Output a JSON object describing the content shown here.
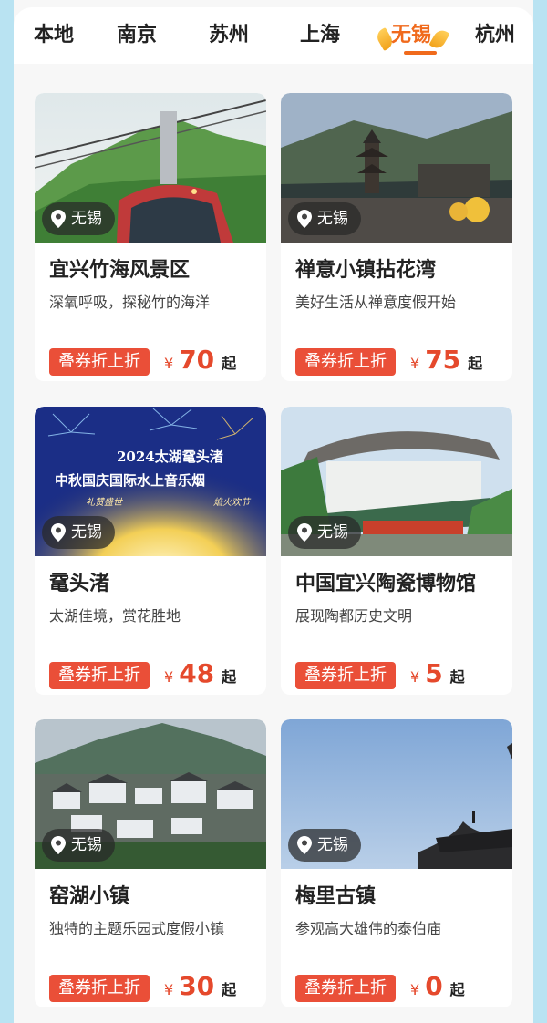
{
  "tabs": [
    {
      "label": "本地",
      "active": false
    },
    {
      "label": "南京",
      "active": false
    },
    {
      "label": "苏州",
      "active": false
    },
    {
      "label": "上海",
      "active": false
    },
    {
      "label": "无锡",
      "active": true
    },
    {
      "label": "杭州",
      "active": false
    }
  ],
  "cards": [
    {
      "location": "无锡",
      "title": "宜兴竹海风景区",
      "desc": "深氧呼吸，探秘竹的海洋",
      "badge": "叠券折上折",
      "currency": "¥",
      "price": "70",
      "suffix": "起"
    },
    {
      "location": "无锡",
      "title": "禅意小镇拈花湾",
      "desc": "美好生活从禅意度假开始",
      "badge": "叠券折上折",
      "currency": "¥",
      "price": "75",
      "suffix": "起"
    },
    {
      "location": "无锡",
      "title": "鼋头渚",
      "desc": "太湖佳境，赏花胜地",
      "badge": "叠券折上折",
      "currency": "¥",
      "price": "48",
      "suffix": "起",
      "image_text": {
        "line1": "2024太湖鼋头渚",
        "line2": "中秋国庆国际水上音乐烟",
        "small_left": "礼赞盛世",
        "small_right": "焰火欢节"
      }
    },
    {
      "location": "无锡",
      "title": "中国宜兴陶瓷博物馆",
      "desc": "展现陶都历史文明",
      "badge": "叠券折上折",
      "currency": "¥",
      "price": "5",
      "suffix": "起"
    },
    {
      "location": "无锡",
      "title": "窑湖小镇",
      "desc": "独特的主题乐园式度假小镇",
      "badge": "叠券折上折",
      "currency": "¥",
      "price": "30",
      "suffix": "起"
    },
    {
      "location": "无锡",
      "title": "梅里古镇",
      "desc": "参观高大雄伟的泰伯庙",
      "badge": "叠券折上折",
      "currency": "¥",
      "price": "0",
      "suffix": "起"
    }
  ],
  "colors": {
    "accent": "#f06a1c",
    "badge": "#ea4f38",
    "price": "#e5492c",
    "background": "#b9e3f2"
  }
}
